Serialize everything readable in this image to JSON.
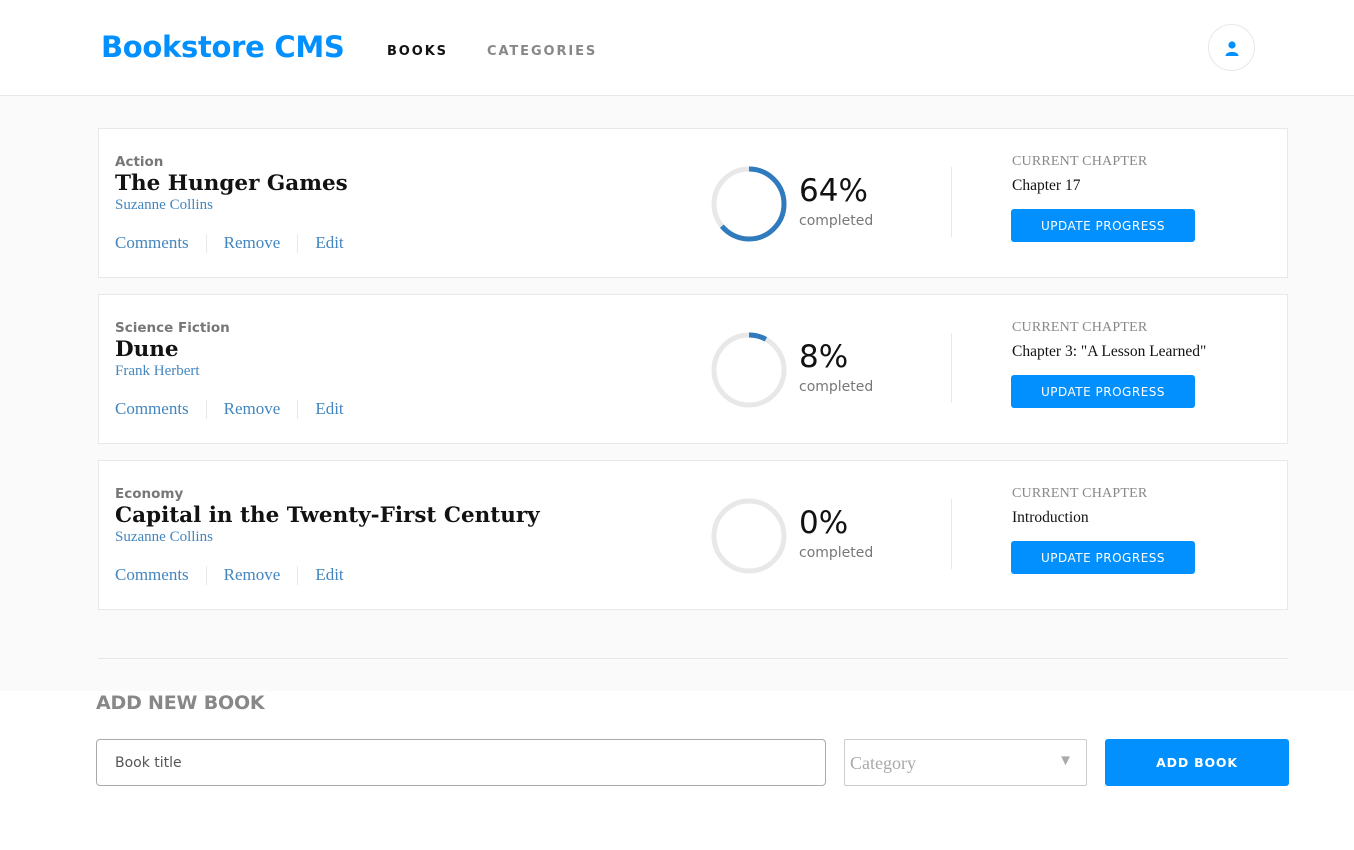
{
  "header": {
    "logo": "Bookstore CMS",
    "nav": [
      "BOOKS",
      "CATEGORIES"
    ],
    "user_icon": "user-icon"
  },
  "books": [
    {
      "genre": "Action",
      "title": "The Hunger Games",
      "author": "Suzanne Collins",
      "actions": [
        "Comments",
        "Remove",
        "Edit"
      ],
      "progress": 64,
      "progress_text": "64%",
      "completed_label": "completed",
      "chapter_label": "CURRENT CHAPTER",
      "chapter": "Chapter 17",
      "update_label": "UPDATE PROGRESS"
    },
    {
      "genre": "Science Fiction",
      "title": "Dune",
      "author": "Frank Herbert",
      "actions": [
        "Comments",
        "Remove",
        "Edit"
      ],
      "progress": 8,
      "progress_text": "8%",
      "completed_label": "completed",
      "chapter_label": "CURRENT CHAPTER",
      "chapter": "Chapter 3: \"A Lesson Learned\"",
      "update_label": "UPDATE PROGRESS"
    },
    {
      "genre": "Economy",
      "title": "Capital in the Twenty-First Century",
      "author": "Suzanne Collins",
      "actions": [
        "Comments",
        "Remove",
        "Edit"
      ],
      "progress": 0,
      "progress_text": "0%",
      "completed_label": "completed",
      "chapter_label": "CURRENT CHAPTER",
      "chapter": "Introduction",
      "update_label": "UPDATE PROGRESS"
    }
  ],
  "form": {
    "title": "ADD NEW BOOK",
    "title_placeholder": "Book title",
    "category_placeholder": "Category",
    "add_label": "ADD BOOK"
  },
  "colors": {
    "brand": "#0290ff",
    "progress": "#307bbe",
    "progress_track": "#e8e8e8",
    "link": "#4386bf"
  }
}
